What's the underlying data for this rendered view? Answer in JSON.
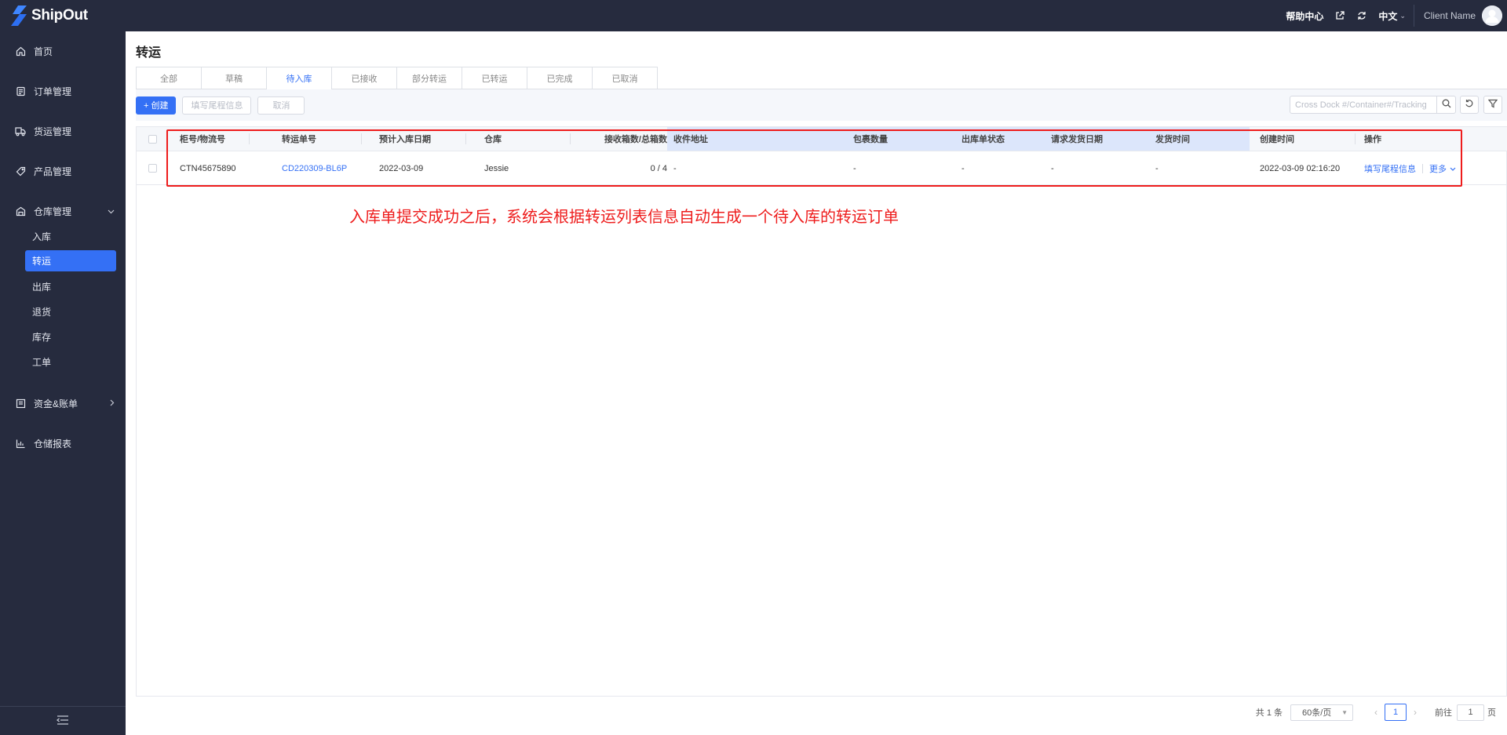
{
  "app": {
    "logo_text": "ShipOut",
    "brand_color": "#3470f5",
    "annotation_color": "#ee1c1c"
  },
  "topbar": {
    "help": "帮助中心",
    "lang": "中文",
    "client": "Client Name",
    "icons": [
      "external-link-icon",
      "refresh-icon",
      "user-avatar"
    ]
  },
  "sidebar": {
    "items": [
      {
        "label": "首页",
        "icon": "home-icon"
      },
      {
        "label": "订单管理",
        "icon": "order-icon"
      },
      {
        "label": "货运管理",
        "icon": "truck-icon"
      },
      {
        "label": "产品管理",
        "icon": "tag-icon"
      },
      {
        "label": "仓库管理",
        "icon": "warehouse-icon"
      }
    ],
    "sub_items": [
      "入库",
      "转运",
      "出库",
      "退货",
      "库存",
      "工单"
    ],
    "bottom_items": [
      {
        "label": "资金&账单",
        "icon": "bill-icon"
      },
      {
        "label": "仓储报表",
        "icon": "chart-icon"
      }
    ]
  },
  "page": {
    "title": "转运",
    "tabs": [
      "全部",
      "草稿",
      "待入库",
      "已接收",
      "部分转运",
      "已转运",
      "已完成",
      "已取消"
    ],
    "active_tab": "待入库"
  },
  "toolbar": {
    "create": "+ 创建",
    "fill_tail": "填写尾程信息",
    "cancel": "取消",
    "search_placeholder": "Cross Dock #/Container#/Tracking"
  },
  "table": {
    "headers": [
      "柜号/物流号",
      "转运单号",
      "预计入库日期",
      "仓库",
      "接收箱数/总箱数",
      "收件地址",
      "包裹数量",
      "出库单状态",
      "请求发货日期",
      "发货时间",
      "创建时间",
      "操作"
    ],
    "rows": [
      {
        "container": "CTN45675890",
        "order_no": "CD220309-BL6P",
        "eta": "2022-03-09",
        "warehouse": "Jessie",
        "boxes": "0 / 4",
        "address": "-",
        "packages": "-",
        "outbound_status": "-",
        "request_date": "-",
        "ship_time": "-",
        "created": "2022-03-09 02:16:20",
        "op_fill": "填写尾程信息",
        "op_more": "更多"
      }
    ]
  },
  "annotation": "入库单提交成功之后，系统会根据转运列表信息自动生成一个待入库的转运订单",
  "pagination": {
    "total": "共 1 条",
    "page_size": "60条/页",
    "current": "1",
    "goto_label": "前往",
    "goto_value": "1",
    "page_label": "页"
  }
}
